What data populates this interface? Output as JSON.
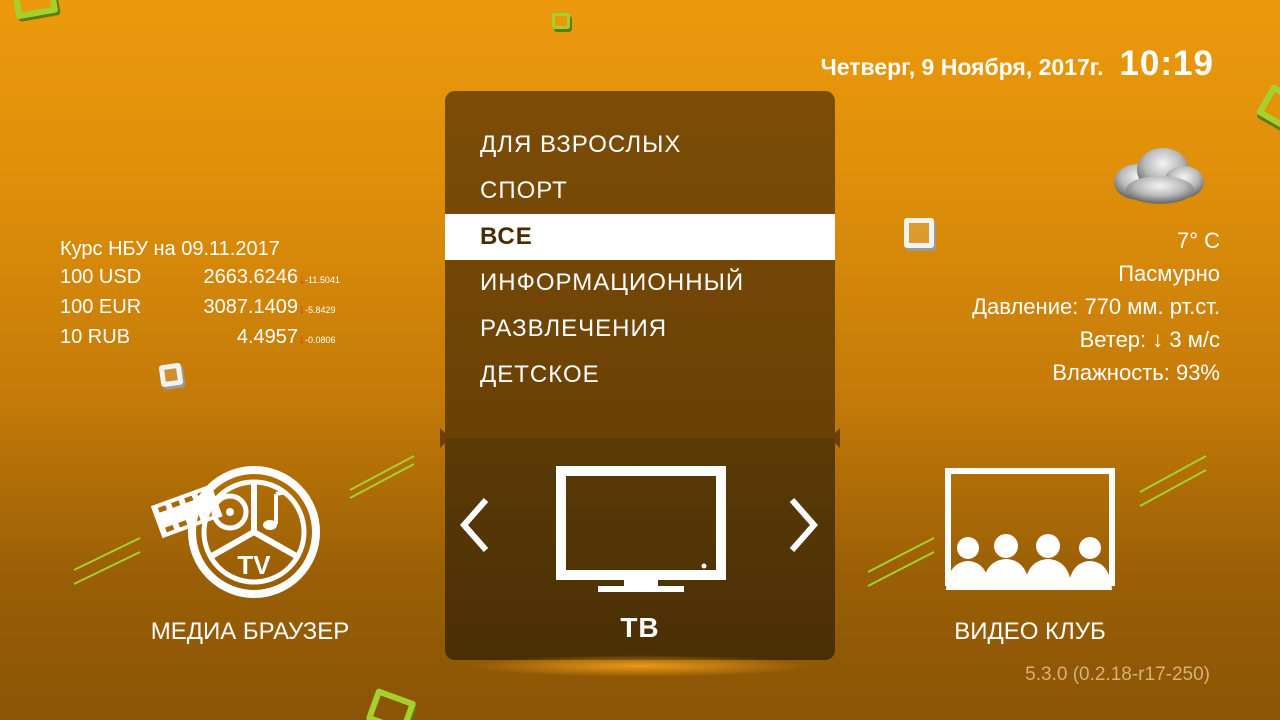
{
  "header": {
    "date": "Четверг, 9 Ноября, 2017г.",
    "time": "10:19"
  },
  "currency": {
    "title": "Курс НБУ на 09.11.2017",
    "rows": [
      {
        "name": "100 USD",
        "value": "2663.6246",
        "delta": "-11.5041"
      },
      {
        "name": "100 EUR",
        "value": "3087.1409",
        "delta": "-5.8429"
      },
      {
        "name": "10 RUB",
        "value": "4.4957",
        "delta": "-0.0806"
      }
    ],
    "down_color": "#e3271f"
  },
  "weather": {
    "icon": "cloud-icon",
    "temperature": "7° C",
    "condition": "Пасмурно",
    "pressure": "Давление: 770 мм. рт.ст.",
    "wind_label": "Ветер:",
    "wind_arrow": "↓",
    "wind_value": "3 м/с",
    "humidity": "Влажность: 93%"
  },
  "menu": {
    "items": [
      {
        "label": "ДЛЯ ВЗРОСЛЫХ"
      },
      {
        "label": "СПОРТ"
      },
      {
        "label": "ВСЕ",
        "selected": true
      },
      {
        "label": "ИНФОРМАЦИОННЫЙ"
      },
      {
        "label": "РАЗВЛЕЧЕНИЯ"
      },
      {
        "label": "ДЕТСКОЕ"
      }
    ]
  },
  "carousel": {
    "left": {
      "label": "МЕДИА БРАУЗЕР",
      "icon": "media-browser-icon"
    },
    "center": {
      "label": "ТВ",
      "icon": "tv-icon"
    },
    "right": {
      "label": "ВИДЕО КЛУБ",
      "icon": "video-club-icon"
    },
    "prev_icon": "chevron-left-icon",
    "next_icon": "chevron-right-icon"
  },
  "version": "5.3.0 (0.2.18-r17-250)",
  "colors": {
    "accent_green": "#a6d12c",
    "panel_brown": "#6a4005",
    "selected_bg": "#ffffff"
  }
}
